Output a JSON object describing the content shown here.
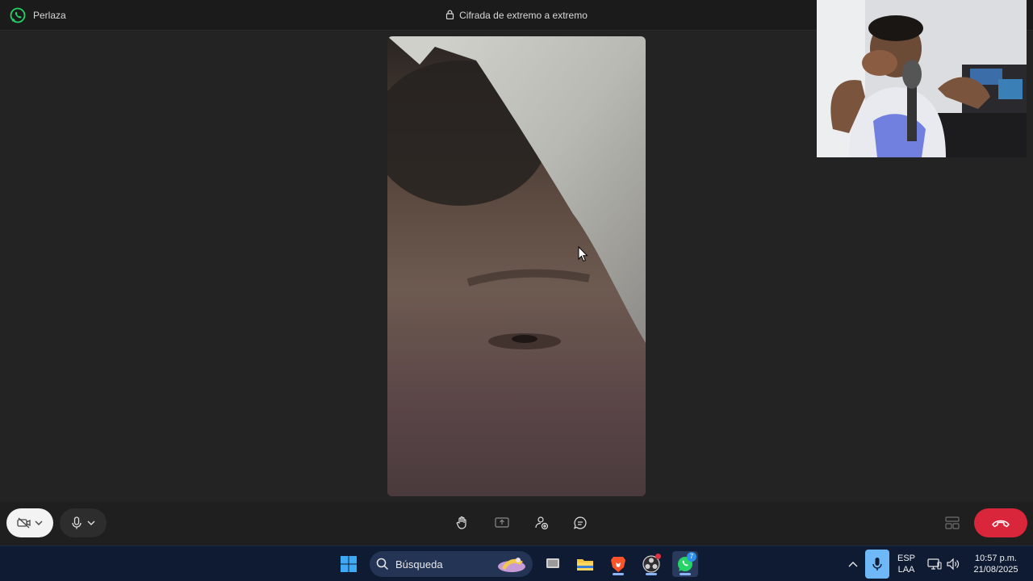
{
  "window": {
    "contact_name": "Perlaza",
    "encryption_notice": "Cifrada de extremo a extremo"
  },
  "icons": {
    "app_logo": "whatsapp-icon",
    "lock": "lock-icon",
    "camera": "camera-off-icon",
    "mic": "microphone-icon",
    "raise_hand": "raise-hand-icon",
    "share": "share-screen-icon",
    "add_person": "add-participant-icon",
    "chat": "chat-icon",
    "layout": "layout-grid-icon",
    "end_call": "end-call-icon"
  },
  "colors": {
    "accent_green": "#25d366",
    "end_call_red": "#d9263a",
    "taskbar_bg": "#0f1b33"
  },
  "taskbar": {
    "search_label": "Búsqueda",
    "whatsapp_badge": "7",
    "language_line1": "ESP",
    "language_line2": "LAA",
    "time": "10:57 p.m.",
    "date": "21/08/2025"
  }
}
